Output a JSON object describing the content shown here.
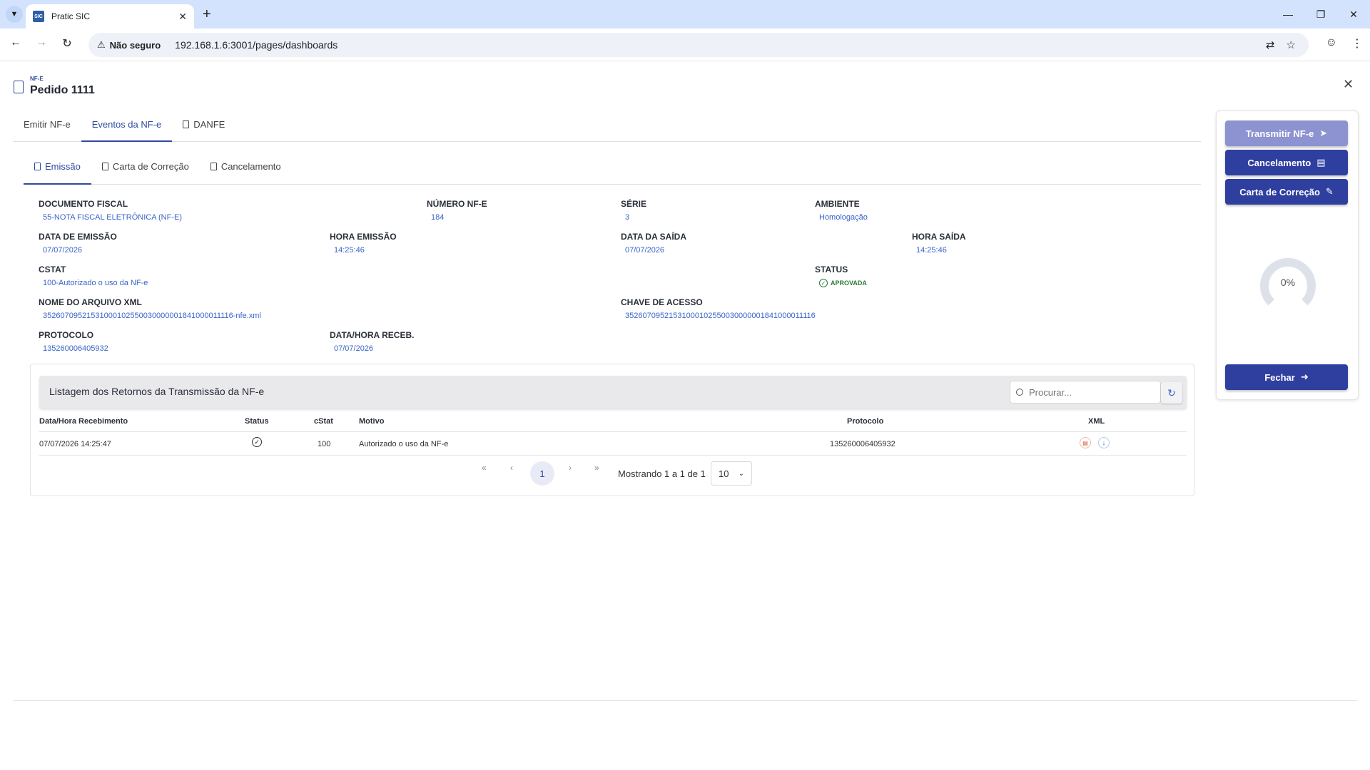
{
  "browser": {
    "tab_title": "Pratic SIC",
    "favicon_text": "SIC",
    "security_label": "Não seguro",
    "url": "192.168.1.6:3001/pages/dashboards"
  },
  "header": {
    "small_label": "NF-E",
    "title": "Pedido 1111"
  },
  "main_tabs": [
    {
      "label": "Emitir NF-e",
      "active": false
    },
    {
      "label": "Eventos da NF-e",
      "active": true
    },
    {
      "label": "DANFE",
      "active": false
    }
  ],
  "sub_tabs": [
    {
      "label": "Emissão",
      "active": true
    },
    {
      "label": "Carta de Correção",
      "active": false
    },
    {
      "label": "Cancelamento",
      "active": false
    }
  ],
  "fields": {
    "documento_fiscal": {
      "label": "DOCUMENTO FISCAL",
      "value": "55-NOTA FISCAL ELETRÔNICA (NF-E)"
    },
    "numero_nfe": {
      "label": "NÚMERO NF-E",
      "value": "184"
    },
    "serie": {
      "label": "SÉRIE",
      "value": "3"
    },
    "ambiente": {
      "label": "AMBIENTE",
      "value": "Homologação"
    },
    "data_emissao": {
      "label": "DATA DE EMISSÃO",
      "value": "07/07/2026"
    },
    "hora_emissao": {
      "label": "HORA EMISSÃO",
      "value": "14:25:46"
    },
    "data_saida": {
      "label": "DATA DA SAÍDA",
      "value": "07/07/2026"
    },
    "hora_saida": {
      "label": "HORA SAÍDA",
      "value": "14:25:46"
    },
    "cstat": {
      "label": "CSTAT",
      "value": "100-Autorizado o uso da NF-e"
    },
    "status": {
      "label": "STATUS",
      "value": "APROVADA"
    },
    "nome_arquivo": {
      "label": "NOME DO ARQUIVO XML",
      "value": "35260709521531000102550030000001841000011116-nfe.xml"
    },
    "chave_acesso": {
      "label": "CHAVE DE ACESSO",
      "value": "35260709521531000102550030000001841000011116"
    },
    "protocolo": {
      "label": "PROTOCOLO",
      "value": "135260006405932"
    },
    "data_hora_receb": {
      "label": "DATA/HORA RECEB.",
      "value": "07/07/2026"
    }
  },
  "listing": {
    "title": "Listagem dos Retornos da Transmissão da NF-e",
    "search_placeholder": "Procurar...",
    "columns": {
      "data_hora": "Data/Hora Recebimento",
      "status": "Status",
      "cstat": "cStat",
      "motivo": "Motivo",
      "protocolo": "Protocolo",
      "xml": "XML"
    },
    "rows": [
      {
        "data_hora": "07/07/2026 14:25:47",
        "status_icon": "check-circle-icon",
        "cstat": "100",
        "motivo": "Autorizado o uso da NF-e",
        "protocolo": "135260006405932"
      }
    ],
    "pagination": {
      "current_page": "1",
      "showing_text": "Mostrando 1 a 1 de 1",
      "per_page": "10"
    }
  },
  "side_panel": {
    "transmit_label": "Transmitir NF-e",
    "cancel_label": "Cancelamento",
    "correction_label": "Carta de Correção",
    "progress_text": "0%",
    "progress_value": 0,
    "close_label": "Fechar"
  },
  "colors": {
    "primary": "#2f3fa0",
    "primary_disabled": "#8c93d0",
    "link_value": "#3a64c8",
    "success": "#2c7a3b"
  }
}
